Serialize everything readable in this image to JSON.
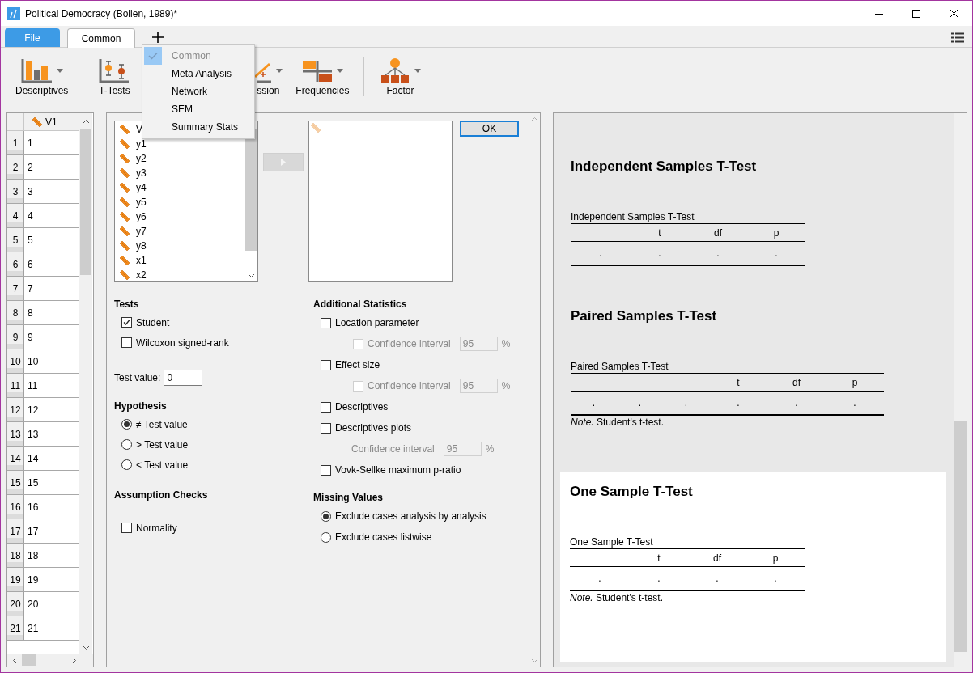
{
  "window": {
    "title": "Political Democracy (Bollen, 1989)*"
  },
  "tabs": [
    {
      "label": "File",
      "kind": "file",
      "selected": false
    },
    {
      "label": "Common",
      "kind": "module",
      "selected": true
    }
  ],
  "module_menu": [
    {
      "label": "Common",
      "checked": true,
      "disabled": true
    },
    {
      "label": "Meta Analysis",
      "checked": false,
      "disabled": false
    },
    {
      "label": "Network",
      "checked": false,
      "disabled": false
    },
    {
      "label": "SEM",
      "checked": false,
      "disabled": false
    },
    {
      "label": "Summary Stats",
      "checked": false,
      "disabled": false
    }
  ],
  "ribbon": [
    {
      "label": "Descriptives",
      "kind": "descriptives"
    },
    {
      "label": "T-Tests",
      "kind": "ttests"
    },
    {
      "label": "ssion",
      "kind": "regression"
    },
    {
      "label": "Frequencies",
      "kind": "frequencies"
    },
    {
      "label": "Factor",
      "kind": "factor"
    }
  ],
  "data_grid": {
    "column": "V1",
    "rows": [
      {
        "number": "1",
        "value": "1"
      },
      {
        "number": "2",
        "value": "2"
      },
      {
        "number": "3",
        "value": "3"
      },
      {
        "number": "4",
        "value": "4"
      },
      {
        "number": "5",
        "value": "5"
      },
      {
        "number": "6",
        "value": "6"
      },
      {
        "number": "7",
        "value": "7"
      },
      {
        "number": "8",
        "value": "8"
      },
      {
        "number": "9",
        "value": "9"
      },
      {
        "number": "10",
        "value": "10"
      },
      {
        "number": "11",
        "value": "11"
      },
      {
        "number": "12",
        "value": "12"
      },
      {
        "number": "13",
        "value": "13"
      },
      {
        "number": "14",
        "value": "14"
      },
      {
        "number": "15",
        "value": "15"
      },
      {
        "number": "16",
        "value": "16"
      },
      {
        "number": "17",
        "value": "17"
      },
      {
        "number": "18",
        "value": "18"
      },
      {
        "number": "19",
        "value": "19"
      },
      {
        "number": "20",
        "value": "20"
      },
      {
        "number": "21",
        "value": "21"
      }
    ]
  },
  "variables": [
    "V",
    "y1",
    "y2",
    "y3",
    "y4",
    "y5",
    "y6",
    "y7",
    "y8",
    "x1",
    "x2"
  ],
  "ok_button": "OK",
  "tests": {
    "title": "Tests",
    "options": [
      {
        "label": "Student",
        "checked": true
      },
      {
        "label": "Wilcoxon signed-rank",
        "checked": false
      }
    ]
  },
  "test_value": {
    "label": "Test value:",
    "value": "0"
  },
  "hypothesis": {
    "title": "Hypothesis",
    "options": [
      {
        "label": "≠ Test value",
        "selected": true
      },
      {
        "label": "> Test value",
        "selected": false
      },
      {
        "label": "< Test value",
        "selected": false
      }
    ]
  },
  "assumption_checks": {
    "title": "Assumption Checks",
    "options": [
      {
        "label": "Normality",
        "checked": false
      }
    ]
  },
  "additional_statistics": {
    "title": "Additional Statistics",
    "items": [
      {
        "kind": "checkbox",
        "label": "Location parameter",
        "checked": false
      },
      {
        "kind": "sub_checkbox",
        "label": "Confidence interval",
        "checked": false,
        "disabled": true,
        "value": "95",
        "unit": "%"
      },
      {
        "kind": "checkbox",
        "label": "Effect size",
        "checked": false
      },
      {
        "kind": "sub_checkbox",
        "label": "Confidence interval",
        "checked": false,
        "disabled": true,
        "value": "95",
        "unit": "%"
      },
      {
        "kind": "checkbox",
        "label": "Descriptives",
        "checked": false
      },
      {
        "kind": "checkbox",
        "label": "Descriptives plots",
        "checked": false
      },
      {
        "kind": "sub_field",
        "label": "Confidence interval",
        "disabled": true,
        "value": "95",
        "unit": "%"
      },
      {
        "kind": "checkbox",
        "label": "Vovk-Sellke maximum p-ratio",
        "checked": false
      }
    ]
  },
  "missing_values": {
    "title": "Missing Values",
    "options": [
      {
        "label": "Exclude cases analysis by analysis",
        "selected": true
      },
      {
        "label": "Exclude cases listwise",
        "selected": false
      }
    ]
  },
  "results": [
    {
      "title": "Independent Samples T-Test",
      "highlighted": false,
      "table": {
        "title": "Independent Samples T-Test",
        "columns": [
          "",
          "t",
          "df",
          "p"
        ],
        "rows": [
          [
            ".",
            ".",
            ".",
            "."
          ]
        ]
      }
    },
    {
      "title": "Paired Samples T-Test",
      "highlighted": false,
      "table": {
        "title": "Paired Samples T-Test",
        "columns": [
          "",
          "",
          "",
          "t",
          "df",
          "p"
        ],
        "rows": [
          [
            ".",
            ".",
            ".",
            ".",
            ".",
            "."
          ]
        ]
      },
      "note": "*Note.* Student's t-test."
    },
    {
      "title": "One Sample T-Test",
      "highlighted": true,
      "table": {
        "title": "One Sample T-Test",
        "columns": [
          "",
          "t",
          "df",
          "p"
        ],
        "rows": [
          [
            ".",
            ".",
            ".",
            "."
          ]
        ]
      },
      "note": "*Note.* Student's t-test."
    }
  ]
}
